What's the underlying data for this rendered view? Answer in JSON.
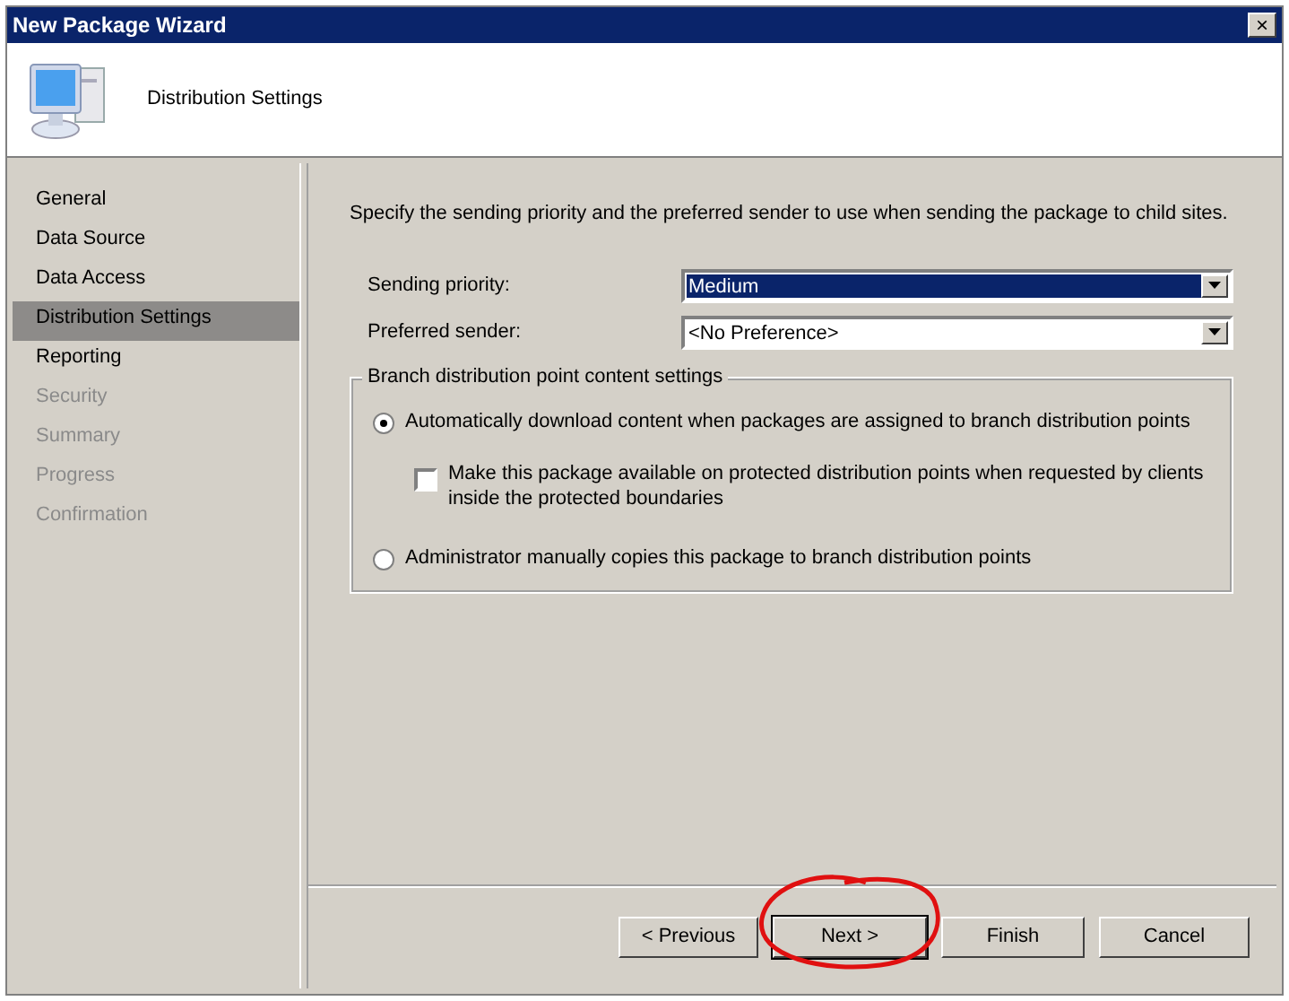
{
  "window": {
    "title": "New Package Wizard",
    "close": "×"
  },
  "header": {
    "title": "Distribution Settings"
  },
  "sidebar": {
    "items": [
      {
        "label": "General",
        "selected": false,
        "disabled": false
      },
      {
        "label": "Data Source",
        "selected": false,
        "disabled": false
      },
      {
        "label": "Data Access",
        "selected": false,
        "disabled": false
      },
      {
        "label": "Distribution Settings",
        "selected": true,
        "disabled": false
      },
      {
        "label": "Reporting",
        "selected": false,
        "disabled": false
      },
      {
        "label": "Security",
        "selected": false,
        "disabled": true
      },
      {
        "label": "Summary",
        "selected": false,
        "disabled": true
      },
      {
        "label": "Progress",
        "selected": false,
        "disabled": true
      },
      {
        "label": "Confirmation",
        "selected": false,
        "disabled": true
      }
    ]
  },
  "description": "Specify the sending priority and the preferred sender to use when sending the package to child sites.",
  "fields": [
    {
      "label": "Sending priority:",
      "value": "Medium",
      "focused": true
    },
    {
      "label": "Preferred sender:",
      "value": "<No Preference>",
      "focused": false
    }
  ],
  "group": {
    "title": "Branch distribution point content settings",
    "options": [
      {
        "kind": "radio",
        "label": "Automatically download content when packages are assigned to branch distribution points",
        "selected": true
      },
      {
        "kind": "checkbox",
        "label": "Make this package available on protected distribution points when requested by clients inside the protected boundaries",
        "checked": false
      },
      {
        "kind": "radio",
        "label": "Administrator manually copies this package to branch distribution points",
        "selected": false
      }
    ]
  },
  "buttons": [
    {
      "label": "< Previous",
      "default": false
    },
    {
      "label": "Next >",
      "default": true
    },
    {
      "label": "Finish",
      "default": false
    },
    {
      "label": "Cancel",
      "default": false
    }
  ]
}
